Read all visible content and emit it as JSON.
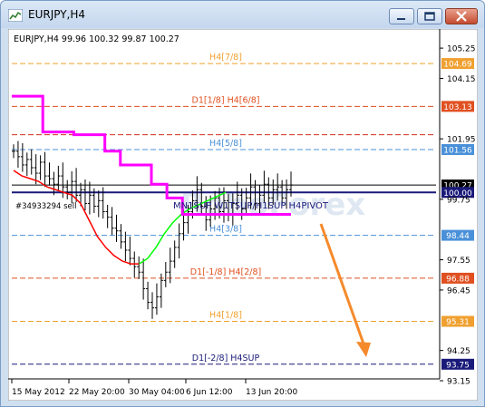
{
  "window": {
    "title": "EURJPY,H4",
    "minimize_icon": "minimize-icon",
    "maximize_icon": "maximize-icon",
    "close_icon": "close-icon"
  },
  "chart_header": "EURJPY,H4  99.96 100.32 99.87 100.27",
  "watermark": "RoboForex",
  "order_label": "#34933294 sell",
  "pivot_label": "MN1SUP W1TSUP/H1SUP H4PIVOT",
  "colors": {
    "background": "#ffffff",
    "candles": "#000000",
    "red_line": "#ff0000",
    "green_line": "#00ff00",
    "magenta_line": "#ff00ff",
    "arrow": "#f58a2c",
    "pivot_navy": "#1a1a7a"
  },
  "chart_data": {
    "type": "line",
    "symbol": "EURJPY",
    "timeframe": "H4",
    "ohlc": {
      "open": 99.96,
      "high": 100.32,
      "low": 99.87,
      "close": 100.27
    },
    "y_range": [
      93.15,
      105.55
    ],
    "y_ticks": [
      105.25,
      104.15,
      101.95,
      99.75,
      97.55,
      96.45,
      94.25,
      93.15
    ],
    "x_ticks": [
      "15 May 2012",
      "22 May 20:00",
      "30 May 04:00",
      "6 Jun 12:00",
      "13 Jun 20:00"
    ],
    "murrey_levels": [
      {
        "label": "H4[7/8]",
        "value": 104.69,
        "color": "#f0a030",
        "price_label": "104.69"
      },
      {
        "label": "D1[1/8] H4[6/8]",
        "value": 103.13,
        "color": "#e05020",
        "price_label": "103.13"
      },
      {
        "label": "",
        "value": 102.1,
        "color": "#d03020",
        "price_label": ""
      },
      {
        "label": "H4[5/8]",
        "value": 101.56,
        "color": "#4a90d9",
        "price_label": "101.56"
      },
      {
        "label": "",
        "value": 100.27,
        "color": "#000000",
        "price_label": "100.27"
      },
      {
        "label": "",
        "value": 100.0,
        "color": "#1a1a7a",
        "price_label": "100.00"
      },
      {
        "label": "H4[3/8]",
        "value": 98.44,
        "color": "#4a90d9",
        "price_label": "98.44"
      },
      {
        "label": "D1[-1/8] H4[2/8]",
        "value": 96.88,
        "color": "#e05020",
        "price_label": "96.88"
      },
      {
        "label": "H4[1/8]",
        "value": 95.31,
        "color": "#f0a030",
        "price_label": "95.31"
      },
      {
        "label": "D1[-2/8] H4SUP",
        "value": 93.75,
        "color": "#1a1a7a",
        "price_label": "93.75"
      }
    ],
    "price_series": [
      101.5,
      101.3,
      101.0,
      101.2,
      100.9,
      100.7,
      101.1,
      100.6,
      100.5,
      100.3,
      100.6,
      100.2,
      100.0,
      100.4,
      99.9,
      100.1,
      99.6,
      99.9,
      99.5,
      99.7,
      99.3,
      99.1,
      98.7,
      98.6,
      98.2,
      97.9,
      97.6,
      97.3,
      97.1,
      96.5,
      96.0,
      95.8,
      96.2,
      96.8,
      97.1,
      97.5,
      98.0,
      98.5,
      98.9,
      99.3,
      99.7,
      100.1,
      99.5,
      99.0,
      99.4,
      99.8,
      99.3,
      99.7,
      99.2,
      99.6,
      99.9,
      99.4,
      99.8,
      100.2,
      99.6,
      99.9,
      100.3,
      99.8,
      100.1,
      100.2,
      99.8,
      100.1,
      100.27
    ],
    "red_series": [
      100.8,
      100.6,
      100.5,
      100.4,
      100.2,
      100.1,
      100.0,
      99.9,
      99.6,
      99.0,
      98.4,
      98.0,
      97.7,
      97.5,
      97.4,
      97.4,
      97.6,
      98.0,
      98.5,
      98.9,
      99.2,
      99.4
    ],
    "magenta_series": [
      103.5,
      103.5,
      102.2,
      102.2,
      102.1,
      102.1,
      101.5,
      101.0,
      101.0,
      100.3,
      99.8,
      99.2,
      99.2,
      99.2,
      99.2,
      99.2,
      99.2,
      99.2,
      99.2
    ]
  }
}
